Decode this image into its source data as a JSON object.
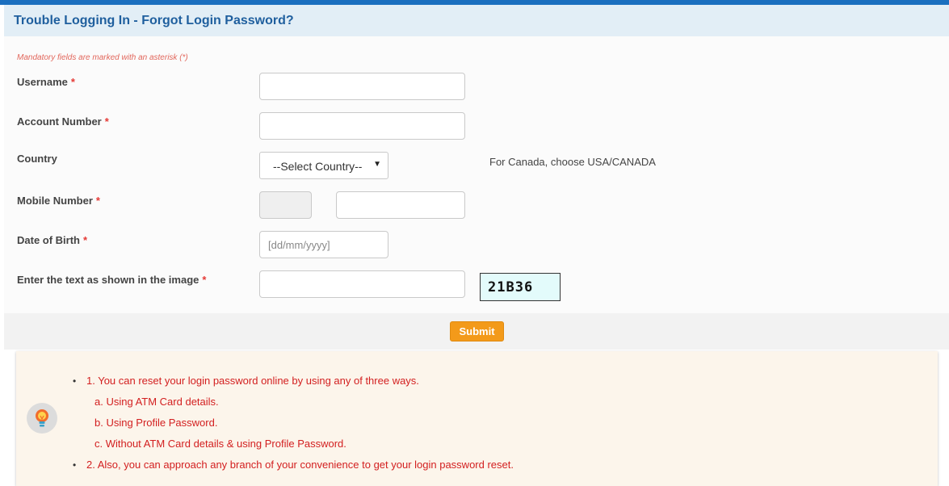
{
  "header": {
    "title": "Trouble Logging In - Forgot Login Password?"
  },
  "form": {
    "mandatory_note": "Mandatory fields are marked with an asterisk (*)",
    "required_mark": "*",
    "username_label": "Username",
    "account_number_label": "Account Number",
    "country_label": "Country",
    "country_selected": "--Select Country--",
    "country_hint": "For Canada, choose USA/CANADA",
    "mobile_label": "Mobile Number",
    "dob_label": "Date of Birth",
    "dob_placeholder": "[dd/mm/yyyy]",
    "captcha_label": "Enter the text as shown in the image",
    "captcha_text": "21B36",
    "submit_label": "Submit"
  },
  "info": {
    "icon": "lightbulb-icon",
    "items": [
      "1. You can reset your login password online by using any of three ways.",
      "a. Using ATM Card details.",
      "b. Using Profile Password.",
      "c. Without ATM Card details & using Profile Password.",
      "2. Also, you can approach any branch of your convenience to get your login password reset."
    ]
  },
  "colors": {
    "accent": "#1a6fbf",
    "title": "#1f5f9e",
    "required": "#e53935",
    "submit": "#f39a1a",
    "info_text": "#d32020",
    "info_bg": "#fcf5eb"
  }
}
